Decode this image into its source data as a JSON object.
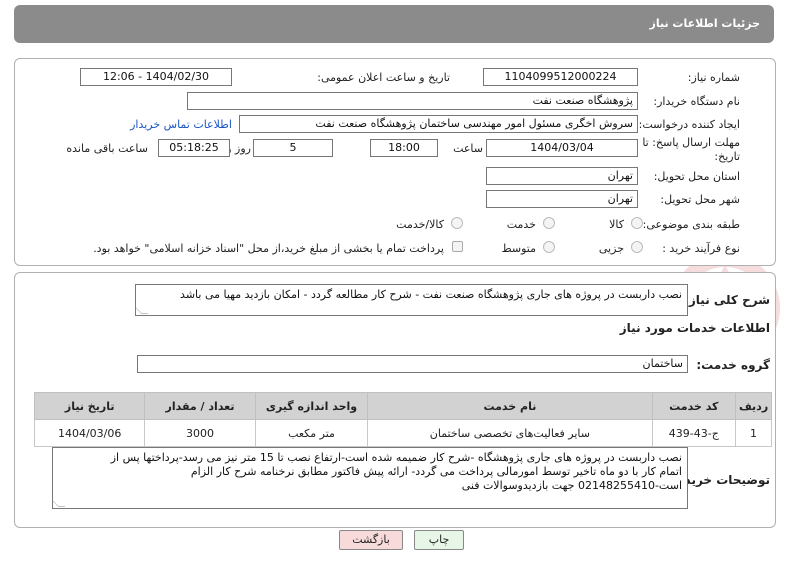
{
  "header": {
    "title": "جزئیات اطلاعات نیاز"
  },
  "form": {
    "need_number_label": "شماره نیاز:",
    "need_number": "1104099512000224",
    "announce_label": "تاریخ و ساعت اعلان عمومی:",
    "announce_value": "1404/02/30 - 12:06",
    "buyer_org_label": "نام دستگاه خریدار:",
    "buyer_org": "پژوهشگاه صنعت نفت",
    "requester_label": "ایجاد کننده درخواست:",
    "requester": "سروش اخگری مسئول امور مهندسی ساختمان پژوهشگاه صنعت نفت",
    "contact_link": "اطلاعات تماس خریدار",
    "deadline_label_1": "مهلت ارسال پاسخ: تا",
    "deadline_label_2": "تاریخ:",
    "deadline_date": "1404/03/04",
    "time_label": "ساعت",
    "deadline_time": "18:00",
    "days_value": "5",
    "days_label": "روز و",
    "remaining_time": "05:18:25",
    "remaining_label": "ساعت باقی مانده",
    "province_label": "استان محل تحویل:",
    "province": "تهران",
    "city_label": "شهر محل تحویل:",
    "city": "تهران",
    "category_label": "طبقه بندی موضوعی:",
    "category_options": [
      "کالا",
      "خدمت",
      "کالا/خدمت"
    ],
    "process_label": "نوع فرآیند خرید :",
    "process_options": [
      "جزیی",
      "متوسط"
    ],
    "payment_note": "پرداخت تمام یا بخشی از مبلغ خرید،از محل \"اسناد خزانه اسلامی\" خواهد بود."
  },
  "description": {
    "label": "شرح کلی نیاز:",
    "text": "نصب داربست در پروژه های جاری پژوهشگاه صنعت نفت - شرح کار مطالعه گردد - امکان بازدید مهیا می باشد"
  },
  "services": {
    "title": "اطلاعات خدمات مورد نیاز",
    "group_label": "گروه خدمت:",
    "group_value": "ساختمان",
    "columns": [
      "ردیف",
      "کد خدمت",
      "نام خدمت",
      "واحد اندازه گیری",
      "تعداد / مقدار",
      "تاریخ نیاز"
    ],
    "rows": [
      {
        "index": "1",
        "code": "ج-43-439",
        "name": "سایر فعالیت‌های تخصصی ساختمان",
        "unit": "متر مکعب",
        "qty": "3000",
        "date": "1404/03/06"
      }
    ]
  },
  "buyer_notes": {
    "label": "توضیحات خریدار:",
    "lines": [
      "نصب داربست در پروژه های جاری پژوهشگاه -شرح کار ضمیمه شده است-ارتفاع نصب تا 15 متر نیز می رسد-پرداختها پس از",
      "اتمام کار با دو ماه تاخیر توسط امورمالی پرداخت می گردد- ارائه پیش فاکتور مطابق نرخنامه شرح کار الزام",
      "است-02148255410 جهت بازدیدوسوالات فنی"
    ]
  },
  "buttons": {
    "print": "چاپ",
    "back": "بازگشت"
  },
  "colors": {
    "header_bg": "#8b8b8b",
    "back_button_bg": "#f7dada",
    "print_button_bg": "#e8f6e8",
    "link": "#1a55c4"
  }
}
